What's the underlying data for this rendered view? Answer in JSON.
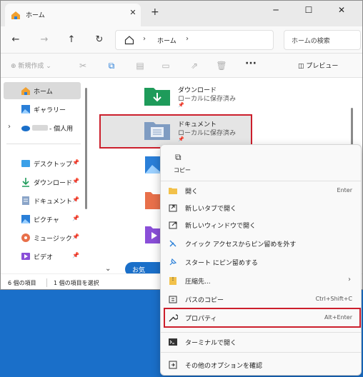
{
  "tab": {
    "label": "ホーム",
    "close": "✕",
    "new": "+"
  },
  "window": {
    "minimize": "─",
    "maximize": "☐",
    "close": "✕"
  },
  "nav": {
    "back": "←",
    "forward": "→",
    "up": "↑",
    "refresh": "↻"
  },
  "address": {
    "sep": "›",
    "crumb": "ホーム"
  },
  "search": {
    "placeholder": "ホームの検索"
  },
  "toolbar": {
    "new_label": "新規作成",
    "new_arrow": "⌄",
    "more": "···",
    "preview_label": "プレビュー"
  },
  "sidebar": {
    "items": [
      {
        "label": "ホーム",
        "icon": "home-icon"
      },
      {
        "label": "ギャラリー",
        "icon": "gallery-icon"
      },
      {
        "label": "- 個人用",
        "icon": "onedrive-icon",
        "expand": "›"
      },
      {
        "label": "デスクトップ",
        "icon": "desktop-icon",
        "pin": "📌"
      },
      {
        "label": "ダウンロード",
        "icon": "download-icon",
        "pin": "📌"
      },
      {
        "label": "ドキュメント",
        "icon": "document-icon",
        "pin": "📌"
      },
      {
        "label": "ピクチャ",
        "icon": "picture-icon",
        "pin": "📌"
      },
      {
        "label": "ミュージック",
        "icon": "music-icon",
        "pin": "📌"
      },
      {
        "label": "ビデオ",
        "icon": "video-icon",
        "pin": "📌"
      }
    ]
  },
  "files": [
    {
      "name": "ダウンロード",
      "status": "ローカルに保存済み",
      "pin": "📌"
    },
    {
      "name": "ドキュメント",
      "status": "ローカルに保存済み",
      "pin": "📌"
    }
  ],
  "status": {
    "count": "6 個の項目",
    "selected": "1 個の項目を選択"
  },
  "quick_access_pill": "お気",
  "context_menu": {
    "copy_label": "コピー",
    "items": [
      {
        "label": "開く",
        "key": "Enter",
        "icon": "folder-open-icon"
      },
      {
        "label": "新しいタブで開く",
        "key": "",
        "icon": "new-tab-icon"
      },
      {
        "label": "新しいウィンドウで開く",
        "key": "",
        "icon": "new-window-icon"
      },
      {
        "label": "クイック アクセスからピン留めを外す",
        "key": "",
        "icon": "unpin-icon"
      },
      {
        "label": "スタート にピン留めする",
        "key": "",
        "icon": "pin-start-icon"
      },
      {
        "label": "圧縮先...",
        "key": "",
        "icon": "zip-icon",
        "arrow": "›"
      },
      {
        "label": "パスのコピー",
        "key": "Ctrl+Shift+C",
        "icon": "copy-path-icon"
      },
      {
        "label": "プロパティ",
        "key": "Alt+Enter",
        "icon": "wrench-icon"
      },
      {
        "label": "ターミナルで開く",
        "key": "",
        "icon": "terminal-icon"
      },
      {
        "label": "その他のオプションを確認",
        "key": "",
        "icon": "more-options-icon"
      }
    ]
  },
  "colors": {
    "accent": "#1a6fc9",
    "highlight": "#cc1f2c"
  }
}
